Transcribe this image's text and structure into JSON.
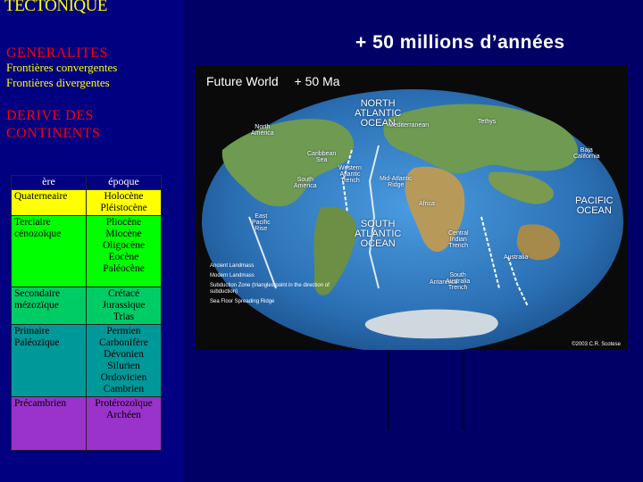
{
  "sidebar": {
    "title": "TECTONIQUE",
    "generalites": "GENERALITES",
    "links": [
      "Frontières convergentes",
      "Frontières divergentes"
    ],
    "derive": "DERIVE DES CONTINENTS",
    "table": {
      "headers": [
        "ère",
        "époque"
      ],
      "rows": [
        {
          "era": "Quaterneaire",
          "epochs": "Holocène\nPléistocène",
          "color": "#ffff00"
        },
        {
          "era": "Terciaire cénozoïque",
          "epochs": "Pliocène\nMiocène\nOligocène\nEocène\nPaléocène",
          "color": "#00ff00"
        },
        {
          "era": "Secondaire mézozïque",
          "epochs": "Crétacé\nJurassique\nTrias",
          "color": "#00cc66"
        },
        {
          "era": "Primaire Paléozïque",
          "epochs": "Permien\nCarbonifère\nDévonien\nSilurien\nOrdovicien\nCambrien",
          "color": "#009999"
        },
        {
          "era": "Précambrien",
          "epochs": "Protérozoïque\nArchéen",
          "color": "#9933cc"
        }
      ]
    }
  },
  "main": {
    "title": "+ 50 millions d’années",
    "map": {
      "caption": "Future World",
      "ma": "+ 50 Ma",
      "labels": {
        "north_atlantic": "NORTH\nATLANTIC\nOCEAN",
        "south_atlantic": "SOUTH\nATLANTIC\nOCEAN",
        "pacific": "PACIFIC\nOCEAN",
        "north_america": "North\nAmerica",
        "south_america": "South\nAmerica",
        "africa": "Africa",
        "antarctica": "Antarctica",
        "australia": "Australia",
        "western_atlantic": "Western\nAtlantic\nTrench",
        "mid_atlantic": "Mid-Atlantic\nRidge",
        "east_pacific": "East\nPacific\nRise",
        "central_indian": "Central\nIndian\nTrench",
        "south_australia": "South\nAustralia\nTrench",
        "baja": "Baja\nCalifornia",
        "caribbean": "Caribbean\nSea",
        "tethys": "Tethys",
        "mediterranean": "Mediterranean"
      },
      "legend": [
        "Ancient Landmass",
        "Modern Landmass",
        "Subduction Zone (triangles point in the direction of subduction)",
        "Sea Floor Spreading Ridge"
      ],
      "copyright": "©2003 C.R. Scotese"
    }
  },
  "colors": {
    "background": "#000066",
    "sidebar": "#000080",
    "title": "#ffff00",
    "heading": "#ff0000",
    "link": "#ffff00",
    "ocean": "#2b6fb3",
    "land": "#5f8f4a"
  }
}
